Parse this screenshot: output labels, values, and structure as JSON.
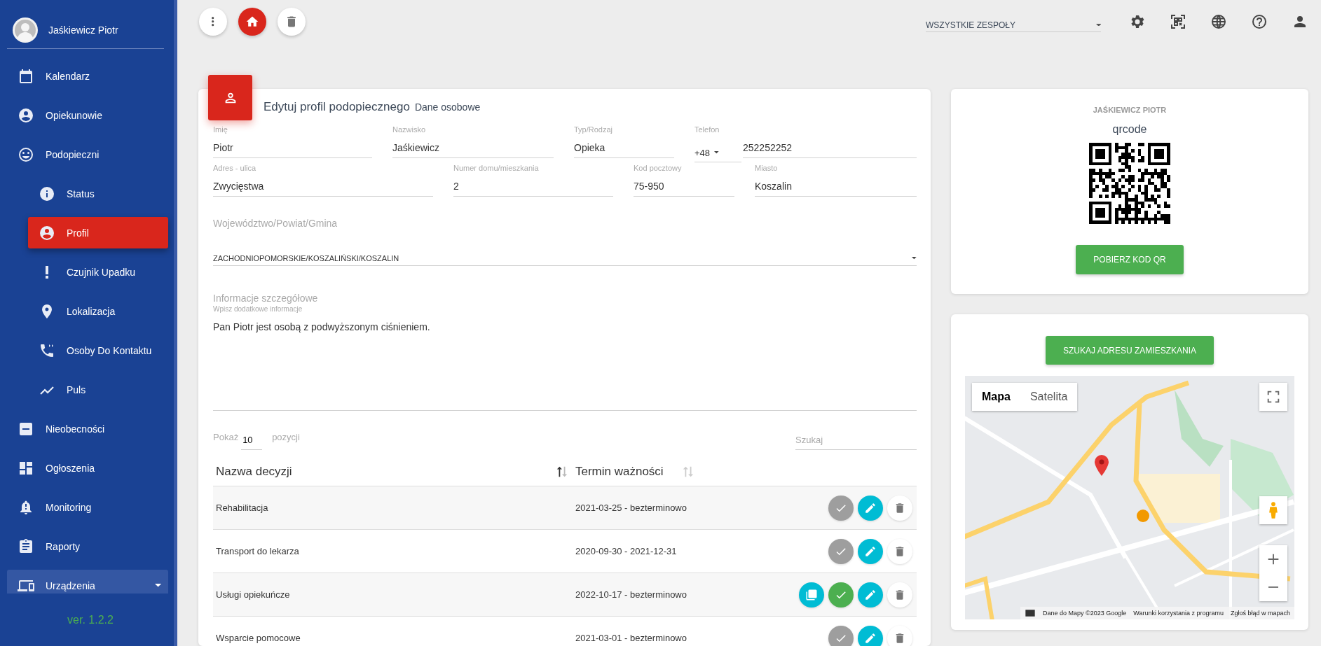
{
  "sidebar": {
    "user": {
      "name": "Jaśkiewicz Piotr"
    },
    "items": [
      {
        "label": "Kalendarz",
        "kind": "main",
        "selected": false
      },
      {
        "label": "Opiekunowie",
        "kind": "main",
        "selected": false
      },
      {
        "label": "Podopieczni",
        "kind": "main",
        "selected": false
      },
      {
        "label": "Status",
        "kind": "sub",
        "selected": false
      },
      {
        "label": "Profil",
        "kind": "sub",
        "selected": true
      },
      {
        "label": "Czujnik Upadku",
        "kind": "sub",
        "selected": false
      },
      {
        "label": "Lokalizacja",
        "kind": "sub",
        "selected": false
      },
      {
        "label": "Osoby Do Kontaktu",
        "kind": "sub",
        "selected": false
      },
      {
        "label": "Puls",
        "kind": "sub",
        "selected": false
      },
      {
        "label": "Nieobecności",
        "kind": "main",
        "selected": false
      },
      {
        "label": "Ogłoszenia",
        "kind": "main",
        "selected": false
      },
      {
        "label": "Monitoring",
        "kind": "main",
        "selected": false
      },
      {
        "label": "Raporty",
        "kind": "main",
        "selected": false
      },
      {
        "label": "Urządzenia",
        "kind": "group",
        "selected": false,
        "expanded": false
      }
    ],
    "version": "ver. 1.2.2"
  },
  "toolbar": {
    "team_select": {
      "value": "WSZYSTKIE ZESPOŁY"
    }
  },
  "profile_form": {
    "title": "Edytuj profil podopiecznego",
    "subtitle": "Dane osobowe",
    "rows": [
      [
        {
          "label": "Imię",
          "value": "Piotr"
        },
        {
          "label": "Nazwisko",
          "value": "Jaśkiewicz"
        },
        {
          "label": "Typ/Rodzaj",
          "value": "Opieka"
        },
        {
          "label": "Telefon",
          "prefix": "+48",
          "value": "252252252"
        }
      ],
      [
        {
          "label": "Adres - ulica",
          "value": "Zwycięstwa"
        },
        {
          "label": "Numer domu/mieszkania",
          "value": "2"
        },
        {
          "label": "Kod pocztowy",
          "value": "75-950"
        },
        {
          "label": "Miasto",
          "value": "Koszalin"
        }
      ]
    ],
    "region": {
      "label": "Województwo/Powiat/Gmina",
      "value": "ZACHODNIOPOMORSKIE/KOSZALIŃSKI/KOSZALIN"
    },
    "details": {
      "label": "Informacje szczegółowe",
      "hint": "Wpisz dodatkowe informacje",
      "value": "Pan Piotr jest osobą z podwyższonym ciśnieniem."
    }
  },
  "decisions": {
    "show_label": "Pokaż",
    "page_size": "10",
    "show_suffix": "pozycji",
    "search": {
      "placeholder": "Szukaj"
    },
    "columns": [
      {
        "label": "Nazwa decyzji",
        "sorted": true
      },
      {
        "label": "Termin ważności",
        "sorted": false
      }
    ],
    "rows": [
      {
        "name": "Rehabilitacja",
        "term": "2021-03-25 - bezterminowo",
        "has_pdf": false,
        "approved": false
      },
      {
        "name": "Transport do lekarza",
        "term": "2020-09-30 - 2021-12-31",
        "has_pdf": false,
        "approved": false
      },
      {
        "name": "Usługi opiekuńcze",
        "term": "2022-10-17 - bezterminowo",
        "has_pdf": true,
        "approved": true
      },
      {
        "name": "Wsparcie pomocowe",
        "term": "2021-03-01 - bezterminowo",
        "has_pdf": false,
        "approved": false
      }
    ]
  },
  "qr_card": {
    "name": "JAŚKIEWICZ PIOTR",
    "caption": "qrcode",
    "button": "POBIERZ KOD QR"
  },
  "map_card": {
    "button": "SZUKAJ ADRESU ZAMIESZKANIA",
    "map": {
      "kind": "picture",
      "map_types": [
        {
          "label": "Mapa",
          "selected": true
        },
        {
          "label": "Satelita",
          "selected": false
        }
      ],
      "attribution": [
        "Dane do Mapy ©2023 Google",
        "Warunki korzystania z programu",
        "Zgłoś błąd w mapach"
      ]
    }
  }
}
